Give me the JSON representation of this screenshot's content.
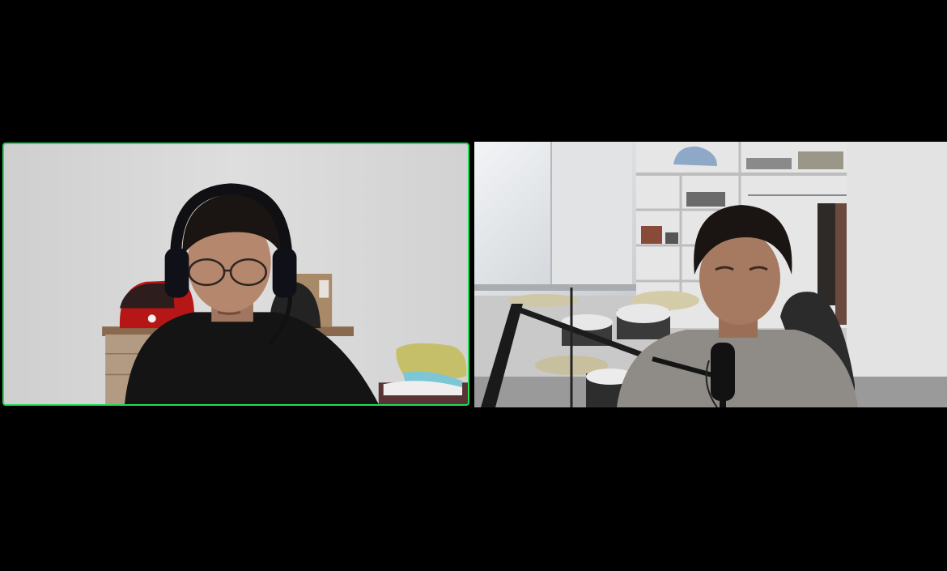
{
  "meeting": {
    "layout": "gallery-view",
    "participants": [
      {
        "id": "p1",
        "active_speaker": true,
        "video_on": true
      },
      {
        "id": "p2",
        "active_speaker": false,
        "video_on": true
      }
    ]
  },
  "colors": {
    "background": "#000000",
    "active_speaker_border": "#23d959"
  }
}
